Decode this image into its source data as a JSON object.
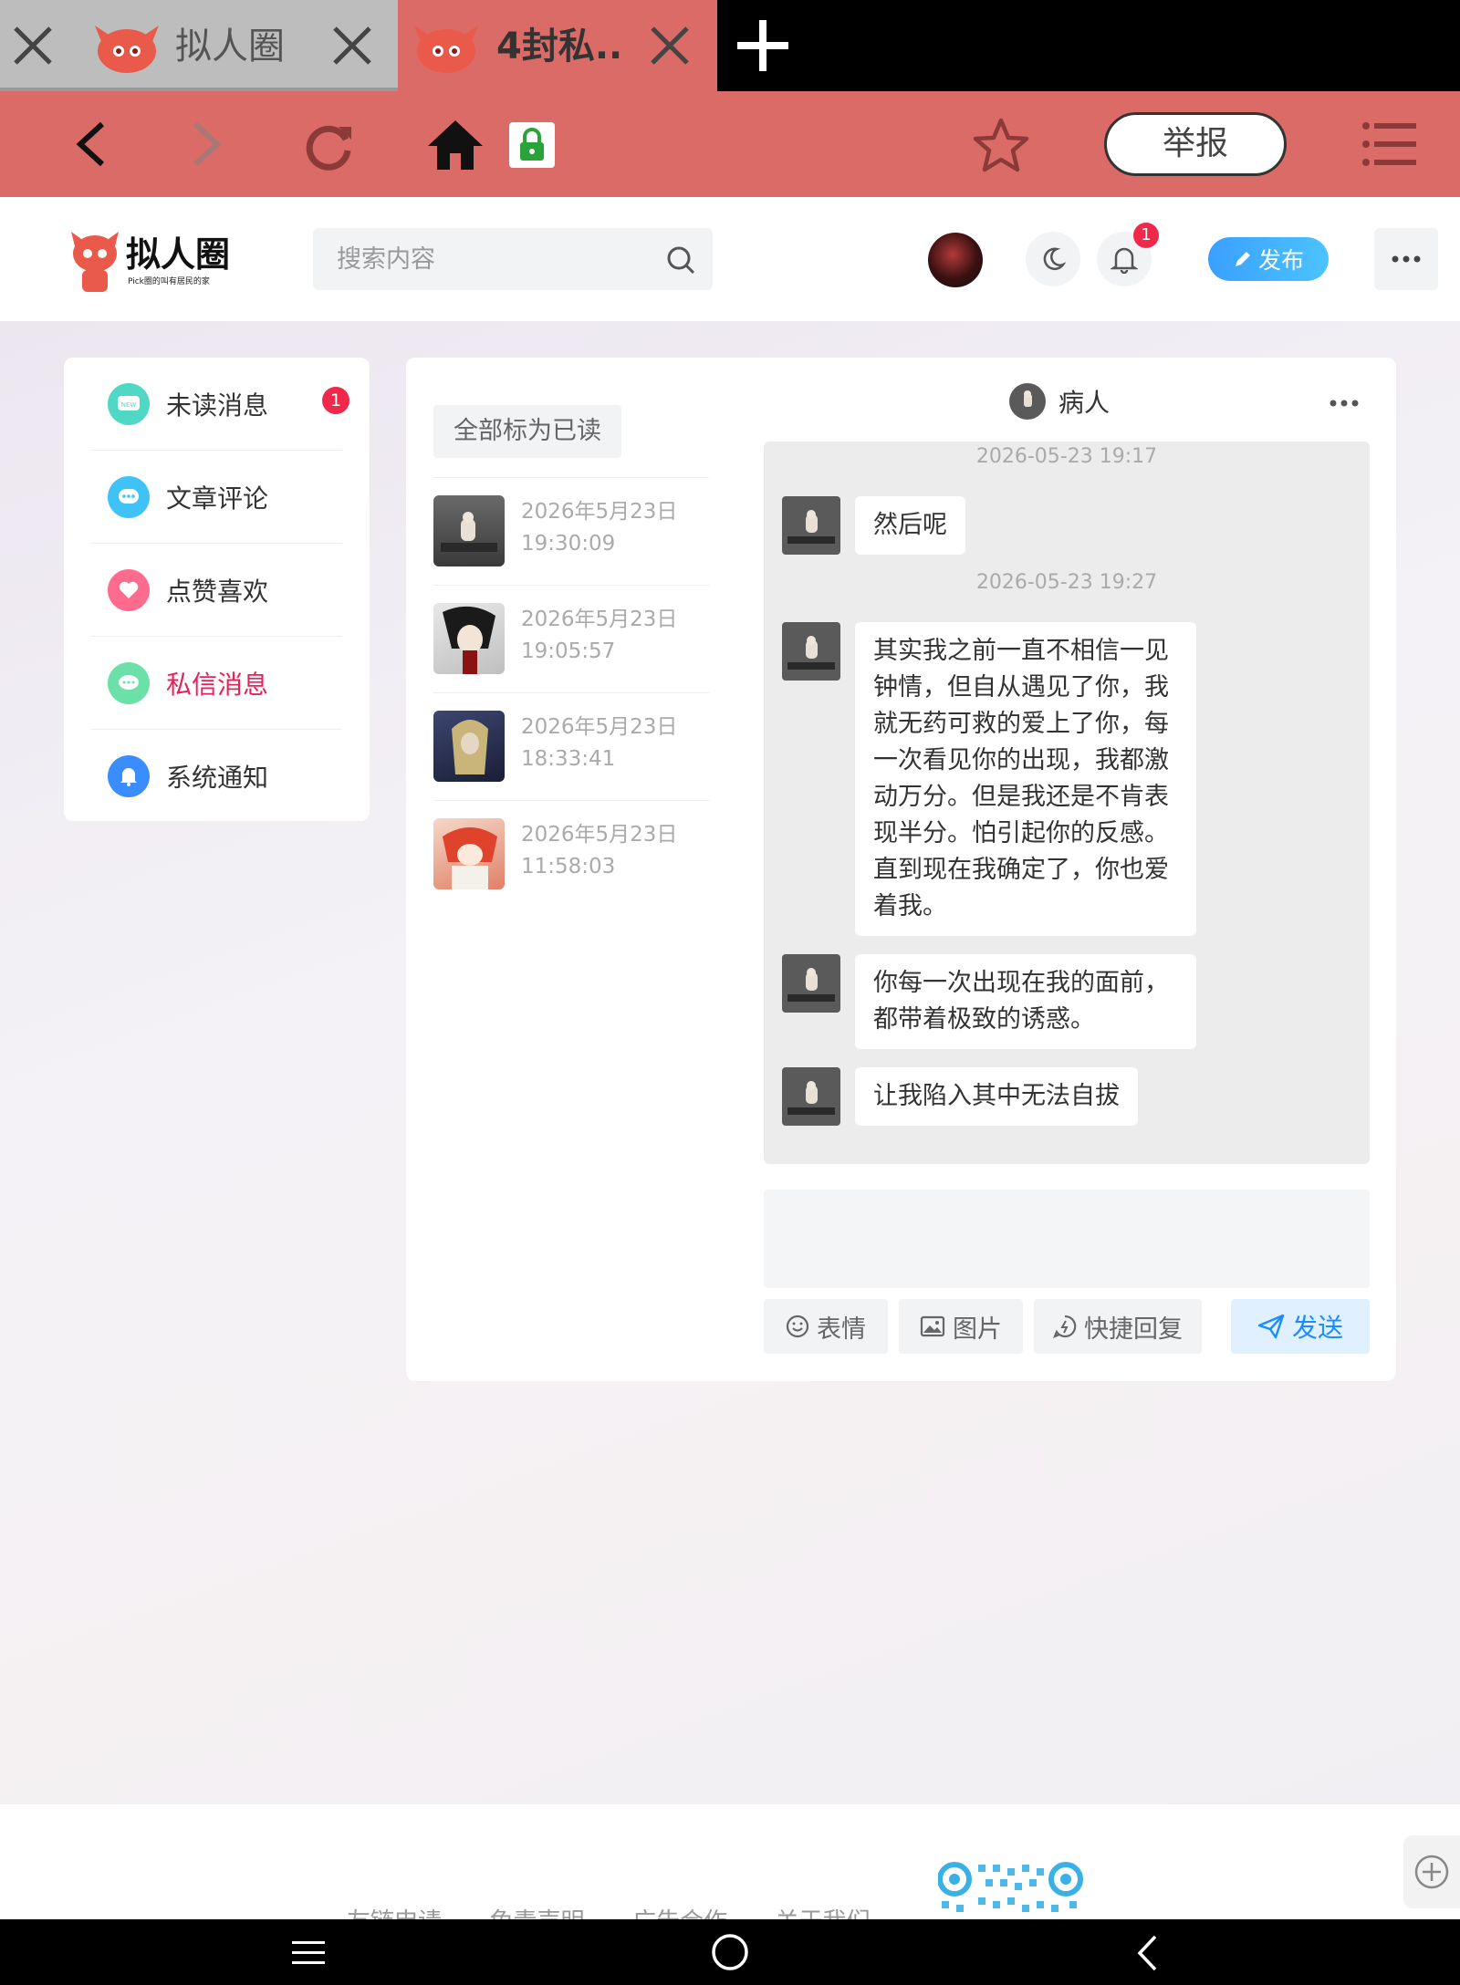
{
  "browser": {
    "tabs": [
      {
        "title": "拟人圈",
        "active": false
      },
      {
        "title": "4封私...",
        "active": true
      }
    ],
    "report_label": "举报",
    "accent_color": "#da6b67"
  },
  "header": {
    "logo_text": "拟人圈",
    "logo_subtitle": "Pick圈的叫有居民的家",
    "search_placeholder": "搜索内容",
    "notification_count": "1",
    "publish_label": "发布"
  },
  "sidebar": {
    "items": [
      {
        "label": "未读消息",
        "badge": "1",
        "icon": "new-message-icon",
        "color": "#4fd8c4"
      },
      {
        "label": "文章评论",
        "icon": "comment-icon",
        "color": "#3fc2f5"
      },
      {
        "label": "点赞喜欢",
        "icon": "heart-icon",
        "color": "#ff6b8f"
      },
      {
        "label": "私信消息",
        "icon": "chat-icon",
        "color": "#6be0a8",
        "active": true
      },
      {
        "label": "系统通知",
        "icon": "bell-icon",
        "color": "#3a8dff"
      }
    ]
  },
  "messages": {
    "mark_all_read": "全部标为已读",
    "conversations": [
      {
        "date": "2026年5月23日",
        "time": "19:30:09"
      },
      {
        "date": "2026年5月23日",
        "time": "19:05:57"
      },
      {
        "date": "2026年5月23日",
        "time": "18:33:41"
      },
      {
        "date": "2026年5月23日",
        "time": "11:58:03"
      }
    ],
    "chat": {
      "contact_name": "病人",
      "entries": [
        {
          "timestamp": "2026-05-23 19:17"
        },
        {
          "text": "然后呢"
        },
        {
          "timestamp": "2026-05-23 19:27"
        },
        {
          "text": "其实我之前一直不相信一见钟情，但自从遇见了你，我就无药可救的爱上了你，每一次看见你的出现，我都激动万分。但是我还是不肯表现半分。怕引起你的反感。直到现在我确定了，你也爱着我。"
        },
        {
          "text": "你每一次出现在我的面前，都带着极致的诱惑。"
        },
        {
          "text": "让我陷入其中无法自拔"
        }
      ]
    },
    "composer": {
      "emoji_label": "表情",
      "image_label": "图片",
      "quick_reply_label": "快捷回复",
      "send_label": "发送"
    }
  },
  "footer": {
    "links": [
      "友链申请",
      "免责声明",
      "广告合作",
      "关于我们"
    ]
  }
}
